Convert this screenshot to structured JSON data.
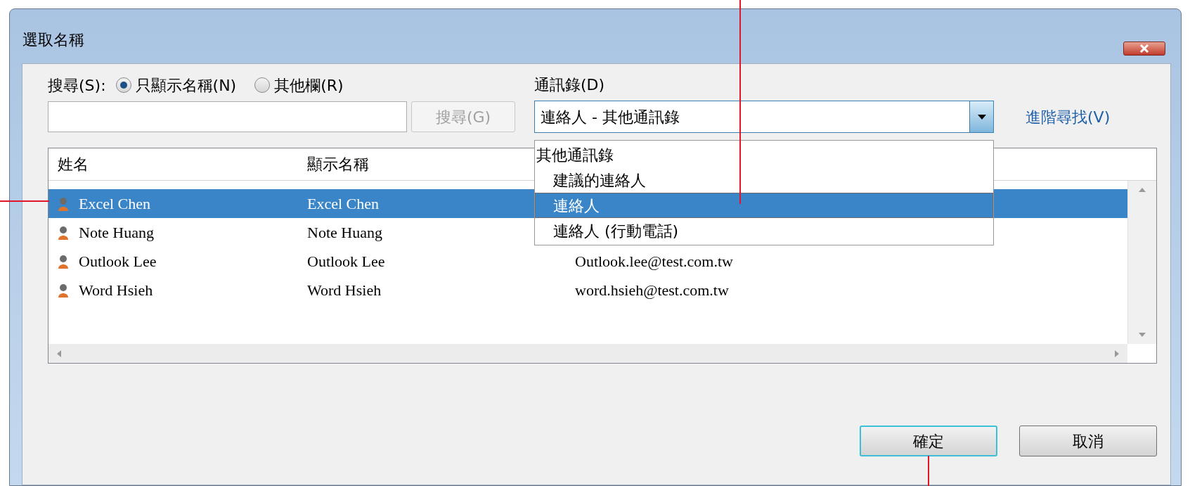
{
  "window": {
    "title": "選取名稱"
  },
  "search": {
    "label": "搜尋(S):",
    "options": [
      {
        "label": "只顯示名稱(N)",
        "selected": true
      },
      {
        "label": "其他欄(R)",
        "selected": false
      }
    ],
    "button": "搜尋(G)",
    "button_disabled": true
  },
  "address_book": {
    "label": "通訊錄(D)",
    "value": "連絡人 - 其他通訊錄",
    "advanced_link": "進階尋找(V)",
    "dropdown": [
      {
        "label": "其他通訊錄",
        "children": [
          {
            "label": "建議的連絡人",
            "selected": false
          },
          {
            "label": "連絡人",
            "selected": true
          },
          {
            "label": "連絡人 (行動電話)",
            "selected": false
          }
        ]
      }
    ]
  },
  "table": {
    "columns": [
      "姓名",
      "顯示名稱"
    ],
    "rows": [
      {
        "cells": [
          "Excel Chen",
          "Excel Chen"
        ],
        "selected": true
      },
      {
        "cells": [
          "Note Huang",
          "Note Huang"
        ],
        "selected": false
      },
      {
        "cells": [
          "Outlook Lee",
          "Outlook Lee",
          "Outlook.lee@test.com.tw"
        ],
        "selected": false
      },
      {
        "cells": [
          "Word Hsieh",
          "Word Hsieh",
          "word.hsieh@test.com.tw"
        ],
        "selected": false
      }
    ]
  },
  "buttons": [
    {
      "label": "確定",
      "default": true
    },
    {
      "label": "取消",
      "default": false
    }
  ]
}
